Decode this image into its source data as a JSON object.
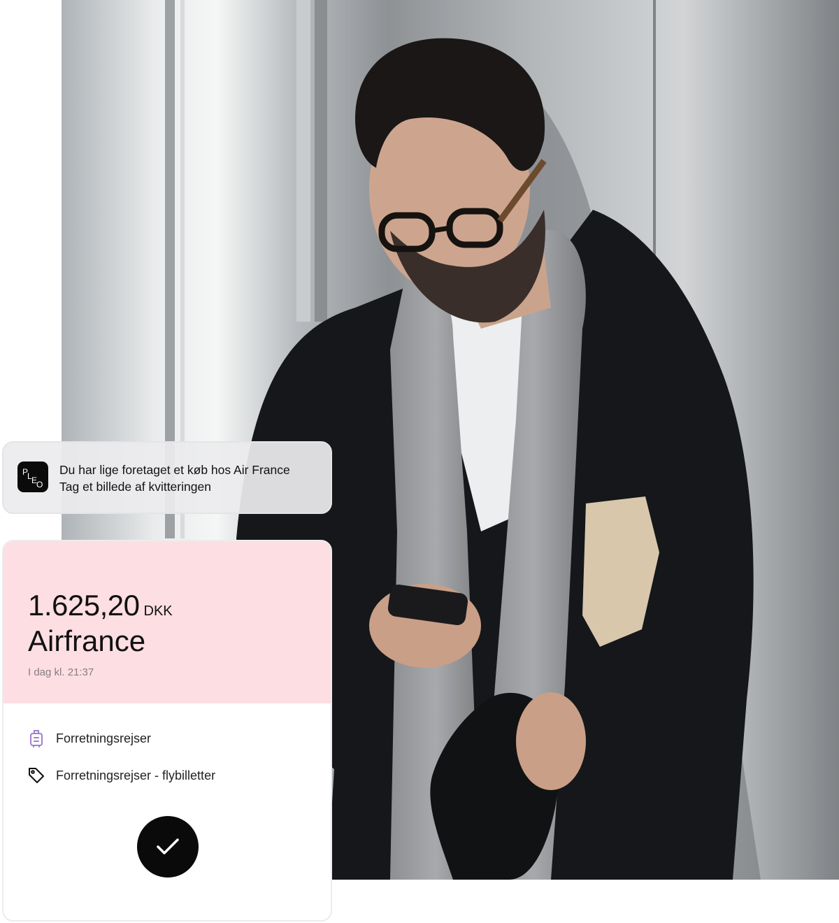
{
  "notification": {
    "app_logo": "pleo-logo",
    "title": "Du har lige foretaget et køb hos Air France",
    "body": "Tag et billede af kvitteringen"
  },
  "expense": {
    "amount": "1.625,20",
    "currency": "DKK",
    "merchant": "Airfrance",
    "timestamp": "I dag kl. 21:37",
    "header_color": "#fcdee3",
    "details": [
      {
        "icon": "suitcase-icon",
        "label": "Forretningsrejser"
      },
      {
        "icon": "tag-icon",
        "label": "Forretningsrejser - flybilletter"
      }
    ],
    "confirm_icon": "checkmark-icon"
  },
  "colors": {
    "accent_purple": "#a07fd0",
    "pink": "#fcdee3",
    "black": "#0a0a0a"
  }
}
